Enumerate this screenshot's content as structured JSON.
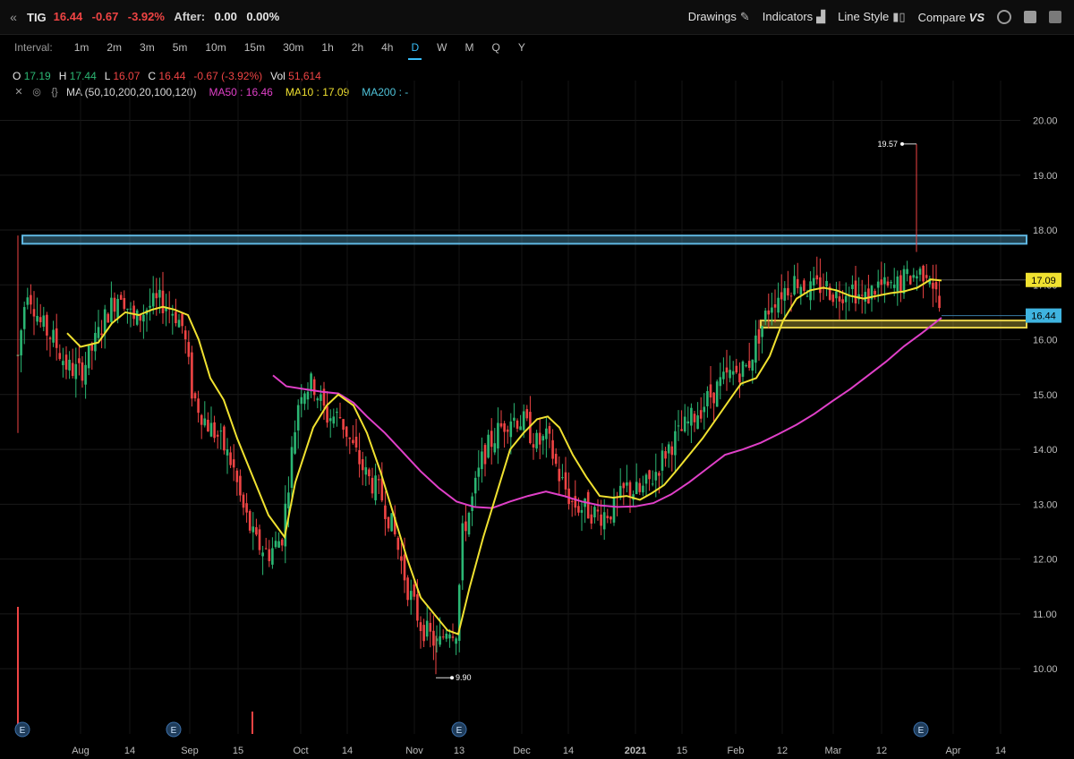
{
  "header": {
    "symbol": "TIG",
    "last": "16.44",
    "change": "-0.67",
    "change_pct": "-3.92%",
    "after_label": "After:",
    "after_change": "0.00",
    "after_pct": "0.00%",
    "tools": {
      "drawings": "Drawings",
      "indicators": "Indicators",
      "line_style": "Line Style",
      "compare": "Compare",
      "compare_vs": "VS"
    }
  },
  "interval": {
    "label": "Interval:",
    "options": [
      "1m",
      "2m",
      "3m",
      "5m",
      "10m",
      "15m",
      "30m",
      "1h",
      "2h",
      "4h",
      "D",
      "W",
      "M",
      "Q",
      "Y"
    ],
    "active": "D"
  },
  "ohlc": {
    "o_label": "O",
    "o": "17.19",
    "h_label": "H",
    "h": "17.44",
    "l_label": "L",
    "l": "16.07",
    "c_label": "C",
    "c": "16.44",
    "chg": "-0.67 (-3.92%)",
    "vol_label": "Vol",
    "vol": "51,614"
  },
  "study": {
    "name": "MA (50,10,200,20,100,120)",
    "ma50": "MA50 : 16.46",
    "ma10": "MA10 : 17.09",
    "ma200": "MA200 : -"
  },
  "colors": {
    "bull": "#2bb673",
    "bear": "#ef4444",
    "ma10": "#f0e130",
    "ma50": "#e040c8",
    "resistance": "#5fb6e0",
    "support": "#e8d34a"
  },
  "chart_data": {
    "type": "candlestick",
    "y_ticks": [
      "10.00",
      "11.00",
      "12.00",
      "13.00",
      "14.00",
      "15.00",
      "16.00",
      "17.00",
      "18.00",
      "19.00",
      "20.00"
    ],
    "ylim": [
      9.3,
      20.4
    ],
    "x_ticks": [
      "Aug",
      "14",
      "Sep",
      "15",
      "Oct",
      "14",
      "Nov",
      "13",
      "Dec",
      "14",
      "2021",
      "15",
      "Feb",
      "12",
      "Mar",
      "12",
      "Apr",
      "14"
    ],
    "price_labels": {
      "ma10": "17.09",
      "last": "16.44"
    },
    "annotations": {
      "high": "19.57",
      "low": "9.90"
    },
    "earnings_marker": "E",
    "zones": {
      "resistance": [
        17.75,
        17.9
      ],
      "support": [
        16.22,
        16.35
      ]
    },
    "ma10_points": [
      [
        75,
        16.12
      ],
      [
        90,
        15.87
      ],
      [
        110,
        15.95
      ],
      [
        125,
        16.3
      ],
      [
        140,
        16.5
      ],
      [
        155,
        16.45
      ],
      [
        170,
        16.55
      ],
      [
        182,
        16.6
      ],
      [
        195,
        16.55
      ],
      [
        210,
        16.45
      ],
      [
        222,
        16.0
      ],
      [
        235,
        15.3
      ],
      [
        250,
        14.9
      ],
      [
        265,
        14.2
      ],
      [
        280,
        13.6
      ],
      [
        300,
        12.8
      ],
      [
        318,
        12.4
      ],
      [
        330,
        13.4
      ],
      [
        350,
        14.4
      ],
      [
        365,
        14.8
      ],
      [
        378,
        15.0
      ],
      [
        395,
        14.8
      ],
      [
        410,
        14.3
      ],
      [
        425,
        13.6
      ],
      [
        440,
        12.8
      ],
      [
        455,
        12.0
      ],
      [
        470,
        11.3
      ],
      [
        485,
        11.0
      ],
      [
        500,
        10.7
      ],
      [
        512,
        10.63
      ],
      [
        525,
        11.5
      ],
      [
        540,
        12.4
      ],
      [
        555,
        13.2
      ],
      [
        570,
        14.0
      ],
      [
        585,
        14.3
      ],
      [
        600,
        14.55
      ],
      [
        612,
        14.6
      ],
      [
        625,
        14.4
      ],
      [
        640,
        13.9
      ],
      [
        655,
        13.5
      ],
      [
        670,
        13.15
      ],
      [
        685,
        13.12
      ],
      [
        700,
        13.15
      ],
      [
        715,
        13.08
      ],
      [
        728,
        13.2
      ],
      [
        742,
        13.35
      ],
      [
        755,
        13.6
      ],
      [
        770,
        13.9
      ],
      [
        785,
        14.2
      ],
      [
        800,
        14.55
      ],
      [
        815,
        14.9
      ],
      [
        828,
        15.2
      ],
      [
        845,
        15.3
      ],
      [
        860,
        15.7
      ],
      [
        875,
        16.35
      ],
      [
        890,
        16.75
      ],
      [
        905,
        16.9
      ],
      [
        920,
        16.95
      ],
      [
        935,
        16.9
      ],
      [
        950,
        16.8
      ],
      [
        965,
        16.75
      ],
      [
        980,
        16.8
      ],
      [
        995,
        16.85
      ],
      [
        1010,
        16.88
      ],
      [
        1025,
        16.95
      ],
      [
        1040,
        17.1
      ],
      [
        1052,
        17.08
      ]
    ],
    "ma50_points": [
      [
        305,
        15.35
      ],
      [
        320,
        15.15
      ],
      [
        340,
        15.1
      ],
      [
        360,
        15.05
      ],
      [
        378,
        15.02
      ],
      [
        395,
        14.85
      ],
      [
        410,
        14.6
      ],
      [
        430,
        14.3
      ],
      [
        450,
        13.95
      ],
      [
        470,
        13.6
      ],
      [
        490,
        13.3
      ],
      [
        510,
        13.05
      ],
      [
        530,
        12.95
      ],
      [
        550,
        12.93
      ],
      [
        570,
        13.05
      ],
      [
        590,
        13.15
      ],
      [
        610,
        13.23
      ],
      [
        630,
        13.15
      ],
      [
        650,
        13.05
      ],
      [
        670,
        12.98
      ],
      [
        690,
        12.95
      ],
      [
        710,
        12.96
      ],
      [
        730,
        13.02
      ],
      [
        750,
        13.18
      ],
      [
        770,
        13.4
      ],
      [
        790,
        13.65
      ],
      [
        810,
        13.9
      ],
      [
        830,
        14.0
      ],
      [
        850,
        14.12
      ],
      [
        870,
        14.28
      ],
      [
        890,
        14.45
      ],
      [
        910,
        14.65
      ],
      [
        930,
        14.88
      ],
      [
        950,
        15.1
      ],
      [
        970,
        15.35
      ],
      [
        990,
        15.6
      ],
      [
        1010,
        15.88
      ],
      [
        1030,
        16.12
      ],
      [
        1052,
        16.4
      ]
    ],
    "candles_anchor": [
      [
        20,
        15.7
      ],
      [
        30,
        17.0
      ],
      [
        45,
        16.3
      ],
      [
        60,
        16.0
      ],
      [
        75,
        15.5
      ],
      [
        90,
        15.4
      ],
      [
        105,
        15.9
      ],
      [
        120,
        16.5
      ],
      [
        135,
        16.9
      ],
      [
        150,
        16.3
      ],
      [
        165,
        16.6
      ],
      [
        180,
        16.7
      ],
      [
        195,
        16.5
      ],
      [
        205,
        16.2
      ],
      [
        215,
        15.0
      ],
      [
        230,
        14.5
      ],
      [
        245,
        14.2
      ],
      [
        260,
        13.7
      ],
      [
        270,
        13.0
      ],
      [
        285,
        12.3
      ],
      [
        300,
        12.1
      ],
      [
        315,
        12.4
      ],
      [
        325,
        13.8
      ],
      [
        335,
        15.1
      ],
      [
        350,
        15.2
      ],
      [
        365,
        14.6
      ],
      [
        380,
        14.6
      ],
      [
        395,
        14.0
      ],
      [
        410,
        13.5
      ],
      [
        425,
        13.2
      ],
      [
        440,
        12.5
      ],
      [
        455,
        11.5
      ],
      [
        470,
        10.8
      ],
      [
        480,
        10.6
      ],
      [
        490,
        10.4
      ],
      [
        500,
        10.8
      ],
      [
        510,
        10.7
      ],
      [
        517,
        12.5
      ],
      [
        525,
        12.9
      ],
      [
        540,
        13.9
      ],
      [
        555,
        14.3
      ],
      [
        570,
        14.6
      ],
      [
        585,
        14.5
      ],
      [
        600,
        14.1
      ],
      [
        612,
        14.2
      ],
      [
        625,
        13.5
      ],
      [
        640,
        13.0
      ],
      [
        655,
        12.9
      ],
      [
        670,
        12.8
      ],
      [
        685,
        12.9
      ],
      [
        700,
        13.3
      ],
      [
        715,
        13.2
      ],
      [
        730,
        13.5
      ],
      [
        745,
        14.0
      ],
      [
        760,
        14.3
      ],
      [
        775,
        14.6
      ],
      [
        790,
        14.9
      ],
      [
        805,
        15.2
      ],
      [
        820,
        15.4
      ],
      [
        835,
        15.5
      ],
      [
        850,
        16.2
      ],
      [
        862,
        16.7
      ],
      [
        875,
        16.9
      ],
      [
        890,
        17.1
      ],
      [
        905,
        16.9
      ],
      [
        920,
        17.0
      ],
      [
        935,
        16.8
      ],
      [
        950,
        17.0
      ],
      [
        965,
        16.7
      ],
      [
        980,
        17.0
      ],
      [
        995,
        16.9
      ],
      [
        1010,
        17.1
      ],
      [
        1025,
        17.2
      ],
      [
        1038,
        17.3
      ],
      [
        1052,
        16.44
      ]
    ]
  }
}
